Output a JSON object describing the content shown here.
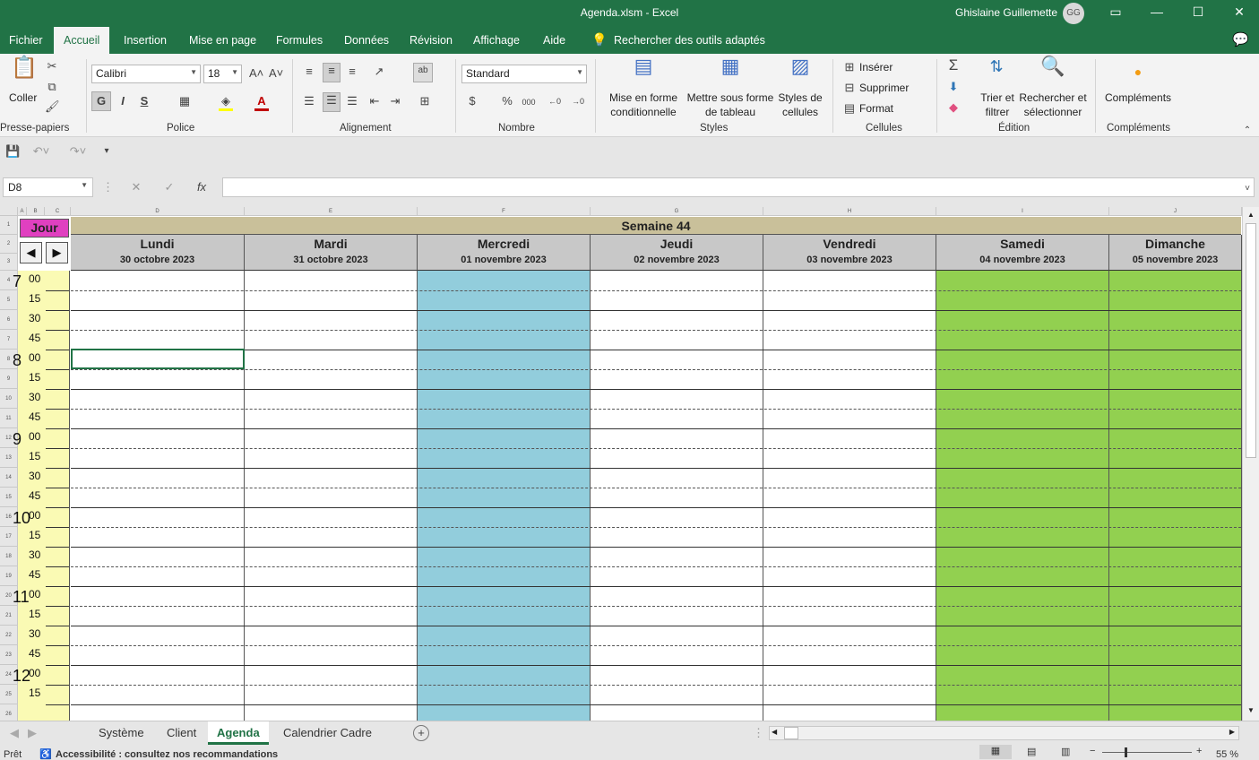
{
  "window": {
    "title": "Agenda.xlsm  -  Excel",
    "user": "Ghislaine Guillemette",
    "user_initials": "GG"
  },
  "tabs": [
    "Fichier",
    "Accueil",
    "Insertion",
    "Mise en page",
    "Formules",
    "Données",
    "Révision",
    "Affichage",
    "Aide"
  ],
  "search_placeholder": "Rechercher des outils adaptés",
  "ribbon": {
    "clipboard": {
      "paste": "Coller",
      "label": "Presse-papiers"
    },
    "font": {
      "name": "Calibri",
      "size": "18",
      "bold": "G",
      "italic": "I",
      "underline": "S",
      "label": "Police"
    },
    "alignment": {
      "label": "Alignement"
    },
    "number": {
      "format": "Standard",
      "percent": "%",
      "thousands": "000",
      "label": "Nombre"
    },
    "styles": {
      "conditional": "Mise en forme conditionnelle",
      "table": "Mettre sous forme de tableau",
      "cellstyles": "Styles de cellules",
      "label": "Styles"
    },
    "cells": {
      "insert": "Insérer",
      "delete": "Supprimer",
      "format": "Format",
      "label": "Cellules"
    },
    "editing": {
      "sort": "Trier et filtrer",
      "find": "Rechercher et sélectionner",
      "label": "Édition"
    },
    "addins": {
      "button": "Compléments",
      "label": "Compléments"
    }
  },
  "formula_bar": {
    "cell_ref": "D8",
    "fx": "fx",
    "content": ""
  },
  "columns": [
    "A",
    "B",
    "C",
    "D",
    "E",
    "F",
    "G",
    "H",
    "I",
    "J"
  ],
  "sheet": {
    "jour_label": "Jour",
    "nav_prev": "◀",
    "nav_next": "▶",
    "week_title": "Semaine 44",
    "days": [
      {
        "name": "Lundi",
        "date": "30 octobre 2023",
        "color": "#ffffff"
      },
      {
        "name": "Mardi",
        "date": "31 octobre 2023",
        "color": "#ffffff"
      },
      {
        "name": "Mercredi",
        "date": "01 novembre 2023",
        "color": "#92cddc"
      },
      {
        "name": "Jeudi",
        "date": "02 novembre 2023",
        "color": "#ffffff"
      },
      {
        "name": "Vendredi",
        "date": "03 novembre 2023",
        "color": "#ffffff"
      },
      {
        "name": "Samedi",
        "date": "04 novembre 2023",
        "color": "#92d050"
      },
      {
        "name": "Dimanche",
        "date": "05 novembre 2023",
        "color": "#92d050"
      }
    ],
    "hours": [
      "7",
      "8",
      "9",
      "10",
      "11",
      "12"
    ],
    "minutes": [
      "00",
      "15",
      "30",
      "45"
    ],
    "row_numbers": [
      "1",
      "2",
      "3",
      "4",
      "5",
      "6",
      "7",
      "8",
      "9",
      "10",
      "11",
      "12",
      "13",
      "14",
      "15",
      "16",
      "17",
      "18",
      "19",
      "20",
      "21",
      "22",
      "23",
      "24",
      "25",
      "26"
    ]
  },
  "sheet_tabs": [
    {
      "name": "Système",
      "active": false
    },
    {
      "name": "Client",
      "active": false
    },
    {
      "name": "Agenda",
      "active": true
    },
    {
      "name": "Calendrier Cadre",
      "active": false
    }
  ],
  "status": {
    "ready": "Prêt",
    "accessibility": "Accessibilité : consultez nos recommandations",
    "zoom": "55 %"
  },
  "colors": {
    "accent": "#217346",
    "jour": "#e040c0",
    "week": "#c9c09a",
    "time": "#fafab4"
  }
}
